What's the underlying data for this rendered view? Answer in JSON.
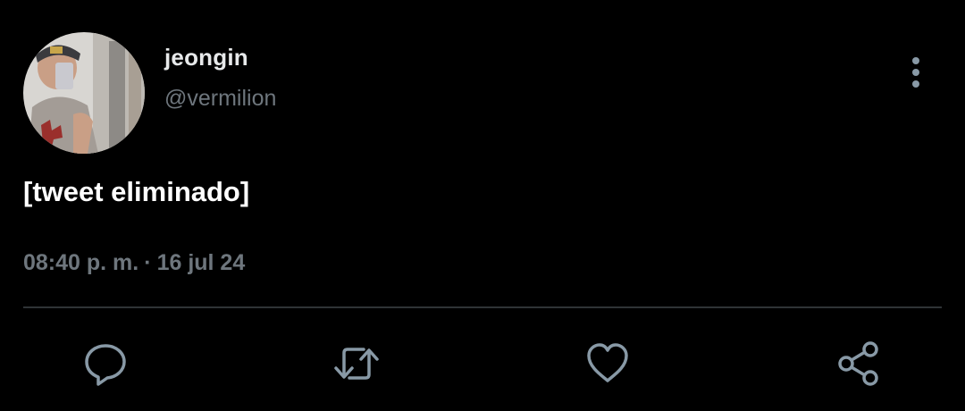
{
  "tweet": {
    "display_name": "jeongin",
    "handle": "@vermilion",
    "text": "[tweet eliminado]",
    "time": "08:40 p. m.",
    "separator": "·",
    "date": "16 jul 24"
  },
  "actions": [
    {
      "icon": "reply-icon"
    },
    {
      "icon": "retweet-icon"
    },
    {
      "icon": "like-icon"
    },
    {
      "icon": "share-icon"
    }
  ],
  "colors": {
    "background": "#000000",
    "primary_text": "#e7e9ea",
    "secondary_text": "#6e767d",
    "divider": "#2f3336",
    "icon": "#8899a6"
  }
}
